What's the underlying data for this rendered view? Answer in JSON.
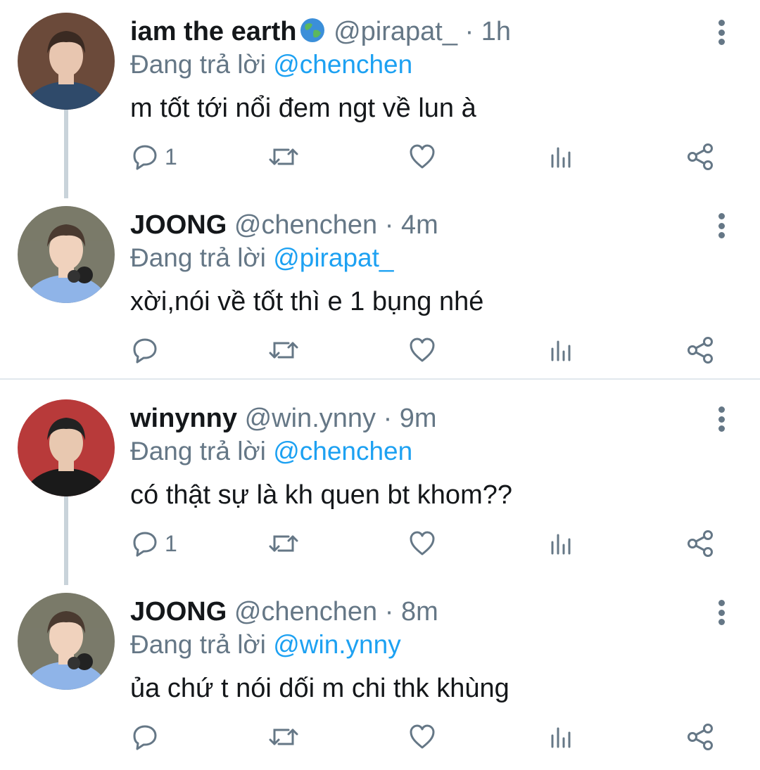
{
  "tweets": [
    {
      "name": "iam the earth",
      "handle": "@pirapat_",
      "dot": "·",
      "time": "1h",
      "replying_prefix": "Đang trả lời",
      "replying_to": "@chenchen",
      "text": "m tốt tới nổi đem ngt về lun à",
      "reply_count": "1",
      "name_emoji": "globe-emoji",
      "avatar_colors": {
        "bg": "#6b4a3a",
        "hair": "#3a2a22",
        "skin": "#e8c6b0",
        "shirt": "#2f4a6a"
      }
    },
    {
      "name": "JOONG",
      "handle": "@chenchen",
      "dot": "·",
      "time": "4m",
      "replying_prefix": "Đang trả lời",
      "replying_to": "@pirapat_",
      "text": "xời,nói về tốt thì e 1 bụng nhé",
      "reply_count": "",
      "avatar_colors": {
        "bg": "#7a7a6a",
        "hair": "#4a3a30",
        "skin": "#f0d2bd",
        "shirt": "#8fb4e8"
      }
    },
    {
      "name": "winynny",
      "handle": "@win.ynny",
      "dot": "·",
      "time": "9m",
      "replying_prefix": "Đang trả lời",
      "replying_to": "@chenchen",
      "text": "có thật sự là kh quen bt khom??",
      "reply_count": "1",
      "avatar_colors": {
        "bg": "#b83a3a",
        "hair": "#222222",
        "skin": "#e8c8b0",
        "shirt": "#1a1a1a"
      }
    },
    {
      "name": "JOONG",
      "handle": "@chenchen",
      "dot": "·",
      "time": "8m",
      "replying_prefix": "Đang trả lời",
      "replying_to": "@win.ynny",
      "text": "ủa chứ t nói dối m chi thk khùng",
      "reply_count": "",
      "avatar_colors": {
        "bg": "#7a7a6a",
        "hair": "#4a3a30",
        "skin": "#f0d2bd",
        "shirt": "#8fb4e8"
      }
    }
  ],
  "icons": {
    "reply": "reply-icon",
    "retweet": "retweet-icon",
    "like": "heart-icon",
    "analytics": "analytics-icon",
    "share": "share-icon",
    "more": "more-vertical-icon"
  },
  "colors": {
    "text": "#14171a",
    "secondary": "#657786",
    "mention": "#1da1f2",
    "thread_line": "#c9d3da",
    "divider": "#e1e8ed"
  }
}
